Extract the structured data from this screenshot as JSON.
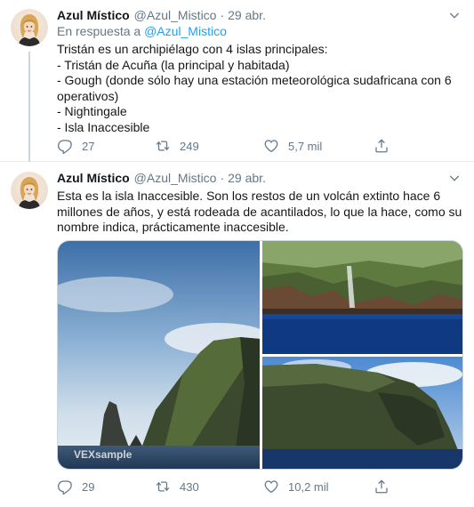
{
  "tweets": [
    {
      "author": {
        "name": "Azul Místico",
        "handle": "@Azul_Mistico"
      },
      "time": "29 abr.",
      "reply_prefix": "En respuesta a",
      "reply_mention": "@Azul_Mistico",
      "lines": [
        "Tristán es un archipiélago con 4 islas principales:",
        "- Tristán de Acuña (la principal y habitada)",
        "- Gough (donde sólo hay una estación meteorológica sudafricana con 6",
        "operativos)",
        "- Nightingale",
        "- Isla Inaccesible"
      ],
      "stats": {
        "replies": "27",
        "retweets": "249",
        "likes": "5,7 mil"
      }
    },
    {
      "author": {
        "name": "Azul Místico",
        "handle": "@Azul_Mistico"
      },
      "time": "29 abr.",
      "lines": [
        "Esta es la isla Inaccesible. Son los restos de un volcán extinto hace 6",
        "millones de años, y está rodeada de acantilados, lo que la hace, como su",
        "nombre indica, prácticamente inaccesible."
      ],
      "media": [
        {
          "watermark": "VEXsample"
        }
      ],
      "stats": {
        "replies": "29",
        "retweets": "430",
        "likes": "10,2 mil"
      }
    }
  ],
  "separator": "·",
  "icons": [
    "reply-icon",
    "retweet-icon",
    "like-icon",
    "share-icon",
    "chevron-down-icon"
  ],
  "colors": {
    "link": "#1da1f2",
    "secondary": "#657786",
    "text": "#14171a",
    "divider": "#e6ecf0"
  }
}
